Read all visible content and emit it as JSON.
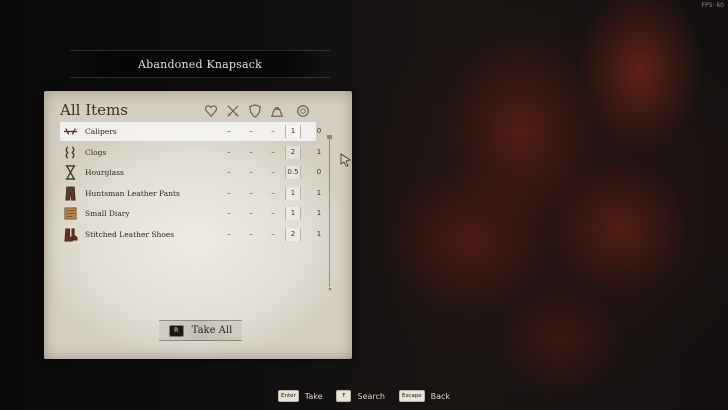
{
  "hud": {
    "fps_text": "FPS: 60"
  },
  "container": {
    "title": "Abandoned Knapsack"
  },
  "panel": {
    "title": "All Items",
    "column_icons": [
      "heart-icon",
      "swords-icon",
      "shield-icon",
      "weight-icon",
      "coin-icon"
    ]
  },
  "items": [
    {
      "name": "Calipers",
      "c1": "–",
      "c2": "–",
      "c3": "–",
      "weight": "1",
      "value": "0",
      "icon": "calipers-icon",
      "selected": true
    },
    {
      "name": "Clogs",
      "c1": "–",
      "c2": "–",
      "c3": "–",
      "weight": "2",
      "value": "1",
      "icon": "clogs-icon"
    },
    {
      "name": "Hourglass",
      "c1": "–",
      "c2": "–",
      "c3": "–",
      "weight": "0.5",
      "value": "0",
      "icon": "hourglass-icon"
    },
    {
      "name": "Huntsman Leather Pants",
      "c1": "–",
      "c2": "–",
      "c3": "–",
      "weight": "1",
      "value": "1",
      "icon": "pants-icon"
    },
    {
      "name": "Small Diary",
      "c1": "–",
      "c2": "–",
      "c3": "–",
      "weight": "1",
      "value": "1",
      "icon": "diary-icon"
    },
    {
      "name": "Stitched Leather Shoes",
      "c1": "–",
      "c2": "–",
      "c3": "–",
      "weight": "2",
      "value": "1",
      "icon": "shoes-icon"
    }
  ],
  "take_all": {
    "key": "R",
    "label": "Take All"
  },
  "hints": [
    {
      "key": "Enter",
      "label": "Take"
    },
    {
      "key": "F",
      "label": "Search"
    },
    {
      "key": "Escape",
      "label": "Back"
    }
  ]
}
